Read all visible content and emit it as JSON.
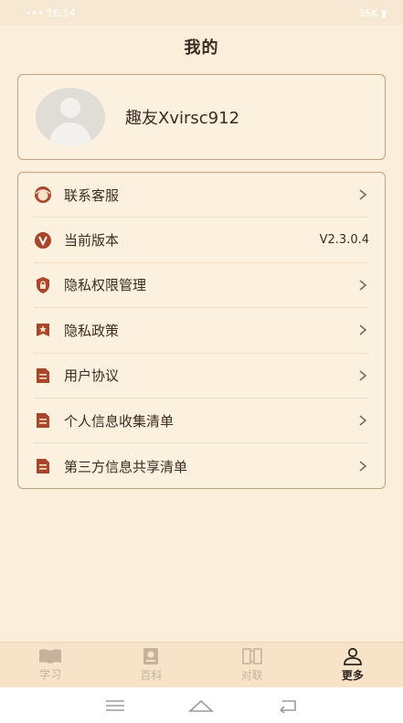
{
  "status": {
    "left": "••• 16:54",
    "right": "36K ▮"
  },
  "page": {
    "title": "我的"
  },
  "profile": {
    "username": "趣友Xvirsc912"
  },
  "menu": [
    {
      "label": "联系客服",
      "icon": "customer-service-icon",
      "value": ""
    },
    {
      "label": "当前版本",
      "icon": "version-icon",
      "value": "V2.3.0.4"
    },
    {
      "label": "隐私权限管理",
      "icon": "shield-icon",
      "value": ""
    },
    {
      "label": "隐私政策",
      "icon": "star-badge-icon",
      "value": ""
    },
    {
      "label": "用户协议",
      "icon": "document-icon",
      "value": ""
    },
    {
      "label": "个人信息收集清单",
      "icon": "document-icon",
      "value": ""
    },
    {
      "label": "第三方信息共享清单",
      "icon": "document-icon",
      "value": ""
    }
  ],
  "tabs": [
    {
      "label": "学习",
      "icon": "book-icon",
      "active": false
    },
    {
      "label": "百科",
      "icon": "encyclopedia-icon",
      "active": false
    },
    {
      "label": "对联",
      "icon": "couplet-icon",
      "active": false
    },
    {
      "label": "更多",
      "icon": "person-icon",
      "active": true
    }
  ],
  "colors": {
    "background": "#fbeedb",
    "accent": "#a8452a",
    "border": "#c8a27a"
  }
}
